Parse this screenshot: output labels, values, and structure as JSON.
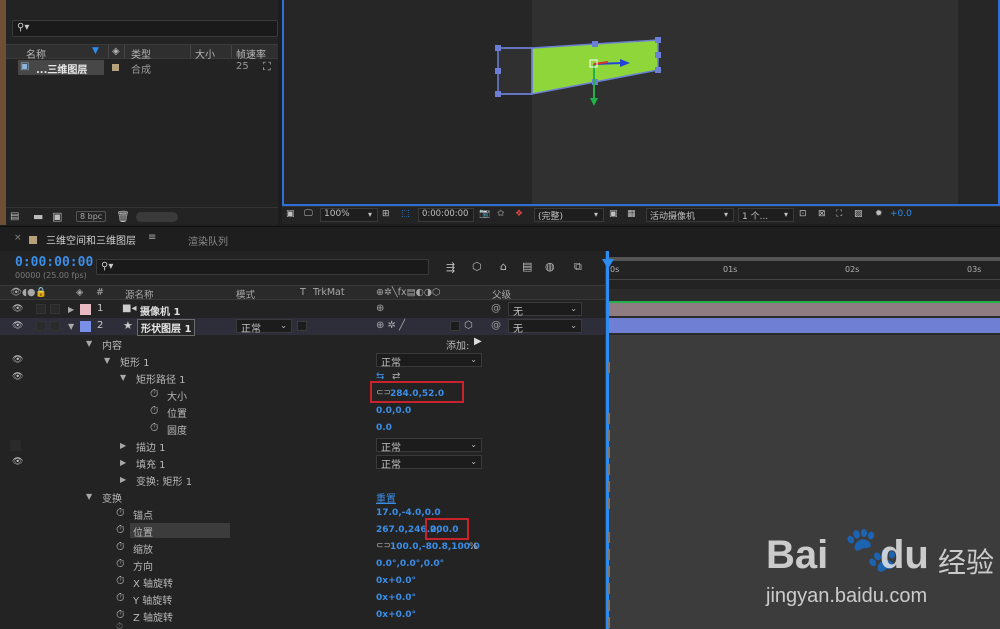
{
  "project": {
    "columns": [
      "名称",
      "类型",
      "大小",
      "帧速率"
    ],
    "item": {
      "name": "...三维图层",
      "type": "合成",
      "fps": "25"
    },
    "bpc": "8 bpc"
  },
  "viewer_toolbar": {
    "zoom": "100%",
    "timecode": "0:00:00:00",
    "quality": "(完整)",
    "camera": "活动摄像机",
    "views": "1 个...",
    "exposure": "+0.0"
  },
  "timeline": {
    "active_tab": "三维空间和三维图层",
    "inactive_tab": "渲染队列",
    "timecode": "0:00:00:00",
    "fps_label": "00000 (25.00 fps)",
    "columns": {
      "hash": "#",
      "source": "源名称",
      "mode": "模式",
      "t": "T",
      "trkmat": "TrkMat",
      "parent": "父级"
    },
    "layers": [
      {
        "num": "1",
        "name": "摄像机 1",
        "parent": "无"
      },
      {
        "num": "2",
        "name": "形状图层 1",
        "mode": "正常",
        "parent": "无"
      }
    ],
    "props": {
      "content": "内容",
      "add": "添加:",
      "rect": "矩形 1",
      "rect_mode": "正常",
      "rect_path": "矩形路径 1",
      "size_label": "大小",
      "size_value": "284.0,52.0",
      "pos_label": "位置",
      "pos_value": "0.0,0.0",
      "round_label": "圆度",
      "round_value": "0.0",
      "stroke": "描边 1",
      "stroke_mode": "正常",
      "fill": "填充 1",
      "fill_mode": "正常",
      "rect_transform": "变换: 矩形 1",
      "transform": "变换",
      "reset": "重置",
      "anchor_label": "锚点",
      "anchor_value": "17.0,-4.0,0.0",
      "position_label": "位置",
      "position_value_a": "267.0,246.0,",
      "position_value_b": "200.0",
      "scale_label": "缩放",
      "scale_value": "100.0,-80.8,100.0",
      "scale_unit": "%",
      "orient_label": "方向",
      "orient_value": "0.0°,0.0°,0.0°",
      "xrot_label": "X 轴旋转",
      "xrot_value": "0x+0.0°",
      "yrot_label": "Y 轴旋转",
      "yrot_value": "0x+0.0°",
      "zrot_label": "Z 轴旋转",
      "zrot_value": "0x+0.0°"
    },
    "ruler": [
      "0s",
      "01s",
      "02s",
      "03s"
    ]
  },
  "watermark": {
    "brand": "Bai",
    "brand2": "du",
    "cn": "经验",
    "url": "jingyan.baidu.com"
  },
  "colors": {
    "accent": "#3b8ee8",
    "shape_fill": "#8fd63a",
    "highlight": "#c8232c"
  }
}
